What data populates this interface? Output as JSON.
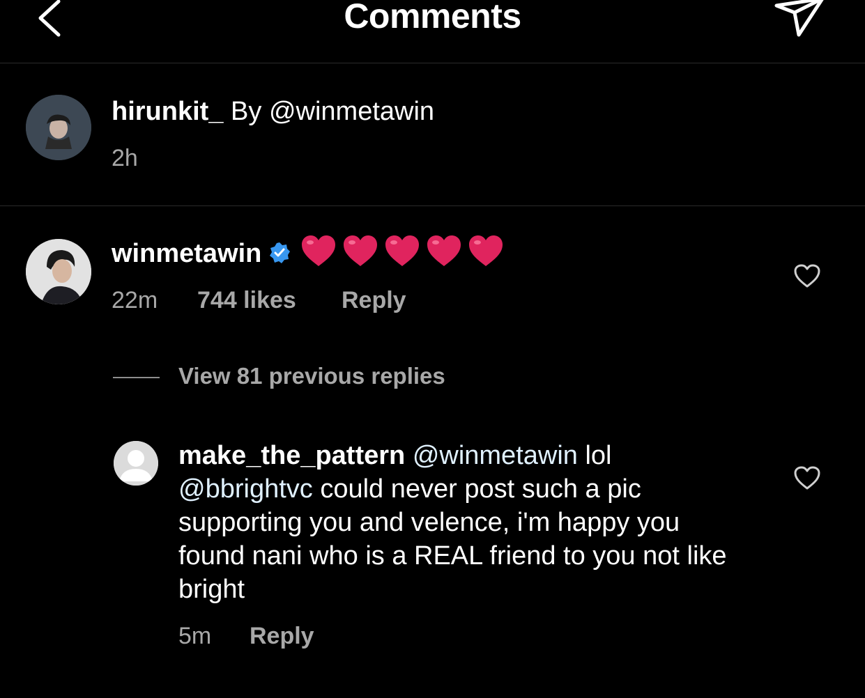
{
  "header": {
    "title": "Comments",
    "back_icon": "chevron-left-icon",
    "share_icon": "paper-plane-icon"
  },
  "caption": {
    "username": "hirunkit_",
    "by_text": "By",
    "mention": "@winmetawin",
    "time": "2h"
  },
  "comment": {
    "username": "winmetawin",
    "verified_icon": "verified-badge-icon",
    "hearts": [
      "❤️",
      "❤️",
      "❤️",
      "❤️",
      "❤️"
    ],
    "time": "22m",
    "likes": "744 likes",
    "reply_label": "Reply",
    "like_icon": "heart-outline-icon",
    "view_replies": "View 81 previous replies"
  },
  "reply": {
    "username": "make_the_pattern",
    "mention1": "@winmetawin",
    "text1": " lol",
    "mention2": "@bbrightvc",
    "text2": " could never post such a pic supporting you and velence, i'm happy you found nani who is a REAL friend to you not like bright",
    "time": "5m",
    "reply_label": "Reply",
    "like_icon": "heart-outline-icon"
  },
  "colors": {
    "background": "#000000",
    "text": "#ffffff",
    "muted": "#a8a8a8",
    "verified": "#3897f0",
    "heart": "#e0245e",
    "divider": "#2b2b2b"
  }
}
